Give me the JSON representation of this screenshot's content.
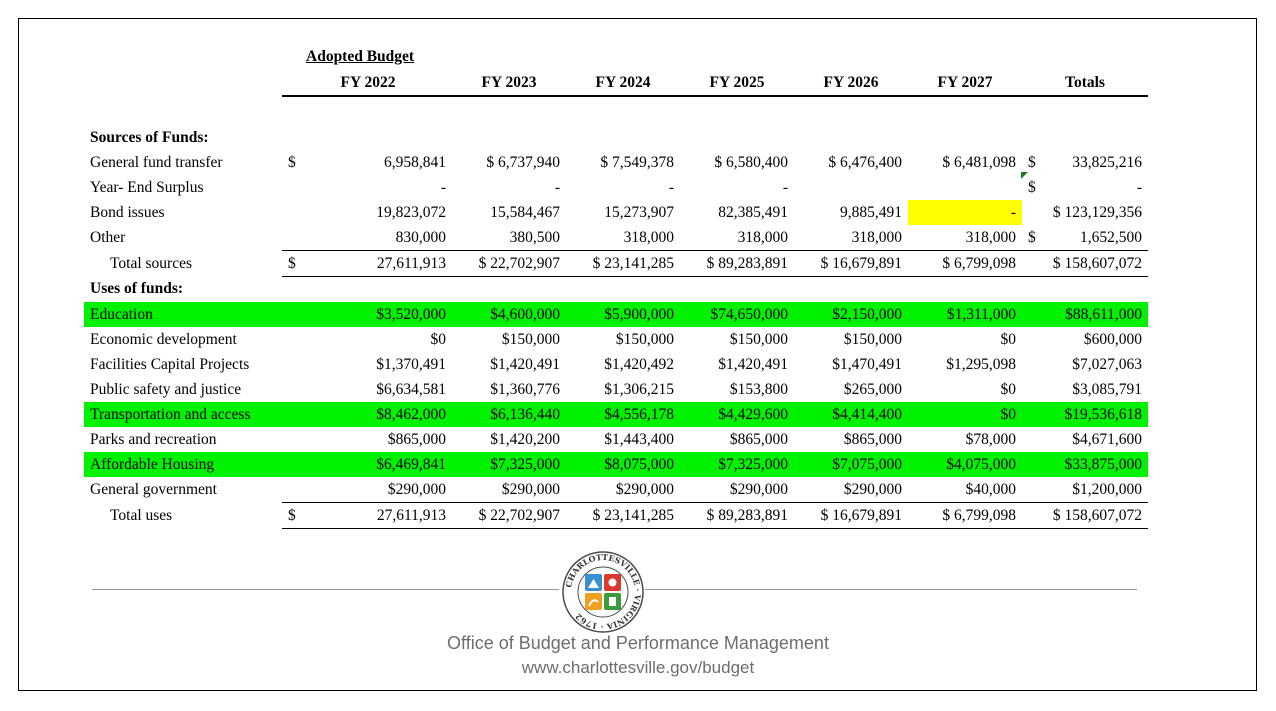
{
  "header": {
    "adopted_label": "Adopted Budget",
    "years": [
      "FY 2022",
      "FY 2023",
      "FY 2024",
      "FY 2025",
      "FY 2026",
      "FY 2027"
    ],
    "totals_label": "Totals"
  },
  "sources": {
    "title": "Sources of Funds:",
    "rows": [
      {
        "label": "General fund transfer",
        "dollar": "$",
        "values": [
          "6,958,841",
          "$ 6,737,940",
          "$ 7,549,378",
          "$ 6,580,400",
          "$ 6,476,400",
          "$ 6,481,098"
        ],
        "total_sign": "$",
        "total": "33,825,216"
      },
      {
        "label": "Year- End Surplus",
        "dollar": "",
        "values": [
          "-",
          "-",
          "-",
          "-",
          "",
          ""
        ],
        "total_sign": "$",
        "total": "-"
      },
      {
        "label": "Bond issues",
        "dollar": "",
        "values": [
          "19,823,072",
          "15,584,467",
          "15,273,907",
          "82,385,491",
          "9,885,491",
          "-"
        ],
        "total_sign": "",
        "total": "$ 123,129,356"
      },
      {
        "label": "Other",
        "dollar": "",
        "values": [
          "830,000",
          "380,500",
          "318,000",
          "318,000",
          "318,000",
          "318,000"
        ],
        "total_sign": "$",
        "total": "1,652,500"
      }
    ],
    "total": {
      "label": "Total sources",
      "dollar": "$",
      "values": [
        "27,611,913",
        "$ 22,702,907",
        "$ 23,141,285",
        "$ 89,283,891",
        "$ 16,679,891",
        "$ 6,799,098"
      ],
      "total": "$ 158,607,072"
    }
  },
  "uses": {
    "title": "Uses of funds:",
    "rows": [
      {
        "label": "Education",
        "values": [
          "$3,520,000",
          "$4,600,000",
          "$5,900,000",
          "$74,650,000",
          "$2,150,000",
          "$1,311,000"
        ],
        "total": "$88,611,000"
      },
      {
        "label": "Economic development",
        "values": [
          "$0",
          "$150,000",
          "$150,000",
          "$150,000",
          "$150,000",
          "$0"
        ],
        "total": "$600,000"
      },
      {
        "label": "Facilities Capital Projects",
        "values": [
          "$1,370,491",
          "$1,420,491",
          "$1,420,492",
          "$1,420,491",
          "$1,470,491",
          "$1,295,098"
        ],
        "total": "$7,027,063"
      },
      {
        "label": "Public safety and justice",
        "values": [
          "$6,634,581",
          "$1,360,776",
          "$1,306,215",
          "$153,800",
          "$265,000",
          "$0"
        ],
        "total": "$3,085,791"
      },
      {
        "label": "Transportation and access",
        "values": [
          "$8,462,000",
          "$6,136,440",
          "$4,556,178",
          "$4,429,600",
          "$4,414,400",
          "$0"
        ],
        "total": "$19,536,618"
      },
      {
        "label": "Parks and recreation",
        "values": [
          "$865,000",
          "$1,420,200",
          "$1,443,400",
          "$865,000",
          "$865,000",
          "$78,000"
        ],
        "total": "$4,671,600"
      },
      {
        "label": "Affordable Housing",
        "values": [
          "$6,469,841",
          "$7,325,000",
          "$8,075,000",
          "$7,325,000",
          "$7,075,000",
          "$4,075,000"
        ],
        "total": "$33,875,000"
      },
      {
        "label": "General government",
        "values": [
          "$290,000",
          "$290,000",
          "$290,000",
          "$290,000",
          "$290,000",
          "$40,000"
        ],
        "total": "$1,200,000"
      }
    ],
    "total": {
      "label": "Total uses",
      "dollar": "$",
      "values": [
        "27,611,913",
        "$ 22,702,907",
        "$ 23,141,285",
        "$ 89,283,891",
        "$ 16,679,891",
        "$ 6,799,098"
      ],
      "total": "$ 158,607,072"
    }
  },
  "highlight_colors": {
    "green": "#00f200",
    "yellow": "#ffff00"
  },
  "footer": {
    "seal_text": "CHARLOTTESVILLE · VIRGINIA · 1762",
    "office": "Office of Budget and Performance Management",
    "url": "www.charlottesville.gov/budget"
  }
}
